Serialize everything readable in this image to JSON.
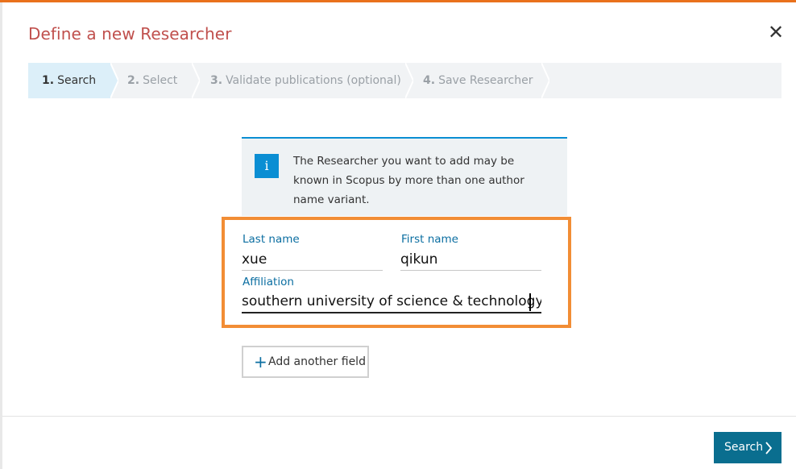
{
  "dialog": {
    "title": "Define a new Researcher",
    "close": "✕"
  },
  "steps": [
    {
      "num": "1.",
      "label": "Search"
    },
    {
      "num": "2.",
      "label": "Select"
    },
    {
      "num": "3.",
      "label": "Validate publications (optional)"
    },
    {
      "num": "4.",
      "label": "Save Researcher"
    }
  ],
  "info": {
    "icon": "i",
    "text": "The Researcher you want to add may be known in Scopus by more than one author name variant."
  },
  "form": {
    "last_name": {
      "label": "Last name",
      "value": "xue"
    },
    "first_name": {
      "label": "First name",
      "value": "qikun"
    },
    "affiliation": {
      "label": "Affiliation",
      "value": "southern university of science & technology"
    }
  },
  "add_field": {
    "icon": "+",
    "label": "Add another field"
  },
  "search_button": {
    "label": "Search"
  },
  "colors": {
    "accent": "#e9711c",
    "title": "#c0504d",
    "primary": "#0a6e8f",
    "highlight": "#f28d35",
    "info": "#0a8ed3"
  }
}
